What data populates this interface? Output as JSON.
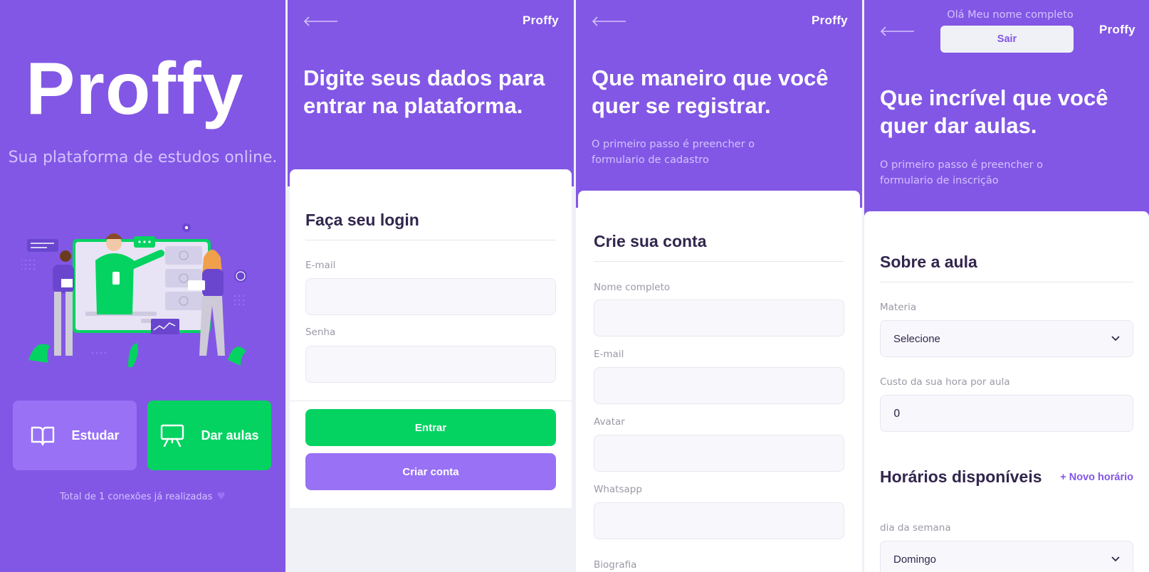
{
  "landing": {
    "logo": "Proffy",
    "tagline": "Sua plataforma de estudos online.",
    "study_label": "Estudar",
    "give_classes_label": "Dar aulas",
    "connections_text": "Total de 1 conexões já realizadas"
  },
  "login": {
    "logo": "Proffy",
    "title": "Digite seus dados para entrar na plataforma.",
    "card_title": "Faça seu login",
    "email_label": "E-mail",
    "email_value": "",
    "password_label": "Senha",
    "password_value": "",
    "enter_label": "Entrar",
    "create_label": "Criar conta"
  },
  "register": {
    "logo": "Proffy",
    "title": "Que maneiro que você quer se registrar.",
    "subtitle": "O primeiro passo é preencher o formulario de cadastro",
    "card_title": "Crie sua conta",
    "fields": [
      {
        "label": "Nome completo",
        "value": ""
      },
      {
        "label": "E-mail",
        "value": ""
      },
      {
        "label": "Avatar",
        "value": ""
      },
      {
        "label": "Whatsapp",
        "value": ""
      }
    ],
    "bio_label": "Biografia"
  },
  "give_classes": {
    "logo": "Proffy",
    "greeting": "Olá Meu nome completo",
    "exit_label": "Sair",
    "title": "Que incrível que você quer dar aulas.",
    "subtitle": "O primeiro passo é preencher o formulario de inscrição",
    "card_title": "Sobre a aula",
    "subject_label": "Materia",
    "subject_value": "Selecione",
    "cost_label": "Custo da sua hora por aula",
    "cost_value": "0",
    "schedule_title": "Horários disponíveis",
    "new_time_label": "+ Novo horário",
    "weekday_label": "dia da semana",
    "weekday_value": "Domingo"
  },
  "colors": {
    "primary": "#8257e5",
    "primary_light": "#9871f5",
    "secondary": "#04d361",
    "title_text": "#32264d",
    "muted_text": "#9c98a6",
    "subtitle_text": "#d4c2ff",
    "input_bg": "#f8f8fc",
    "page_bg": "#f0f0f7"
  },
  "icons": [
    "back-arrow-icon",
    "book-icon",
    "presentation-icon",
    "heart-icon",
    "chevron-down-icon"
  ]
}
